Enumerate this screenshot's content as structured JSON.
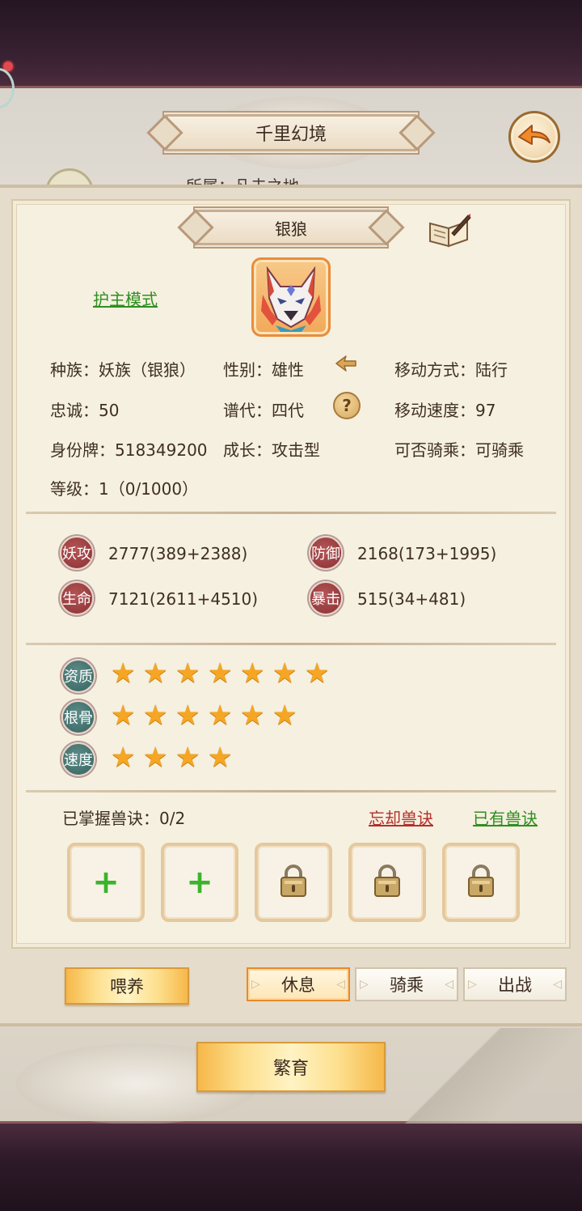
{
  "header": {
    "title": "千里幻境",
    "hidden_text": "所属：凡夫之地"
  },
  "pet": {
    "name": "银狼",
    "mode_link": "护主模式",
    "info": {
      "race": "种族：妖族（银狼）",
      "gender": "性别：雄性",
      "move_type": "移动方式：陆行",
      "loyalty": "忠诚：50",
      "generation": "谱代：四代",
      "move_speed": "移动速度：97",
      "id_tag": "身份牌：518349200",
      "growth": "成长：攻击型",
      "rideable": "可否骑乘：可骑乘",
      "level": "等级：1（0/1000）"
    }
  },
  "stats": [
    {
      "badge": "妖攻",
      "value": "2777(389+2388)"
    },
    {
      "badge": "防御",
      "value": "2168(173+1995)"
    },
    {
      "badge": "生命",
      "value": "7121(2611+4510)"
    },
    {
      "badge": "暴击",
      "value": "515(34+481)"
    }
  ],
  "ratings": [
    {
      "badge": "资质",
      "stars": 7
    },
    {
      "badge": "根骨",
      "stars": 6
    },
    {
      "badge": "速度",
      "stars": 4
    }
  ],
  "skills": {
    "label": "已掌握兽诀：0/2",
    "forget_link": "忘却兽诀",
    "owned_link": "已有兽诀",
    "slots": [
      "add",
      "add",
      "locked",
      "locked",
      "locked"
    ]
  },
  "actions": {
    "feed": "喂养",
    "rest": "休息",
    "ride": "骑乘",
    "battle": "出战",
    "breed": "繁育"
  },
  "colors": {
    "accent_orange": "#e88a2a",
    "link_green": "#2f8f22",
    "link_red": "#b3302a",
    "star": "#f6a623"
  }
}
